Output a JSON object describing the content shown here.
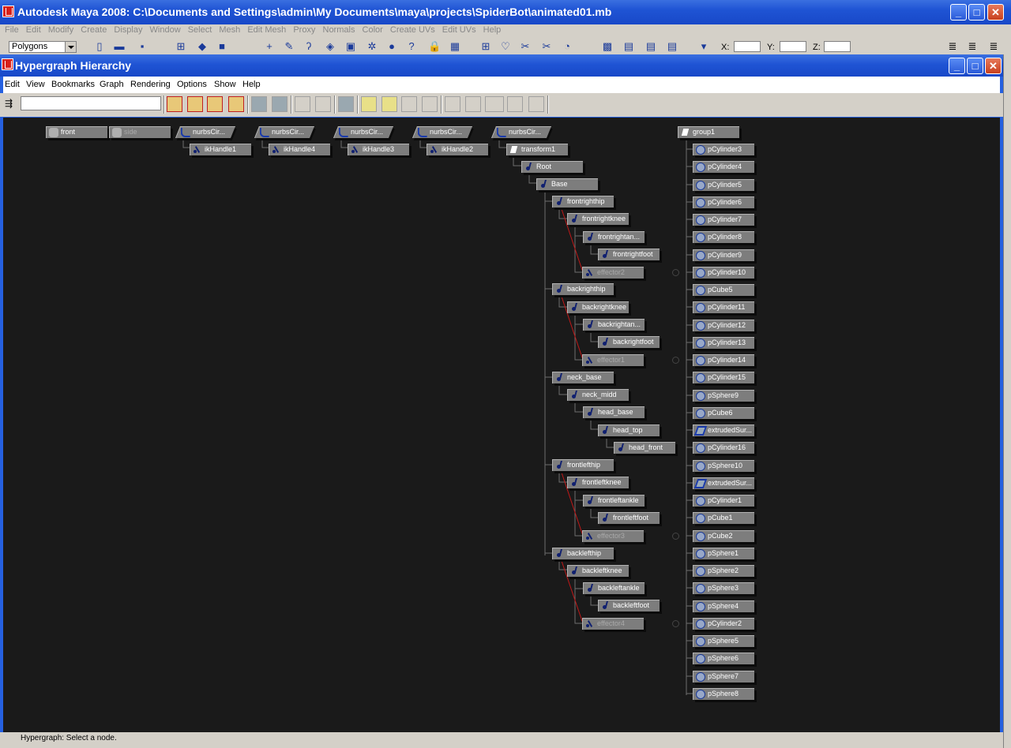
{
  "app": {
    "title": "Autodesk Maya 2008: C:\\Documents and Settings\\admin\\My Documents\\maya\\projects\\SpiderBot\\animated01.mb",
    "menus": [
      "File",
      "Edit",
      "Modify",
      "Create",
      "Display",
      "Window",
      "Select",
      "Mesh",
      "Edit Mesh",
      "Proxy",
      "Normals",
      "Color",
      "Create UVs",
      "Edit UVs",
      "Help"
    ],
    "menu_set": "Polygons",
    "coord_labels": {
      "x": "X:",
      "y": "Y:",
      "z": "Z:"
    },
    "window_buttons": {
      "min": "_",
      "max": "□",
      "close": "✕"
    }
  },
  "hypergraph": {
    "title": "Hypergraph Hierarchy",
    "menus": [
      "Edit",
      "View",
      "Bookmarks",
      "Graph",
      "Rendering",
      "Options",
      "Show",
      "Help"
    ],
    "status": "Hypergraph: Select a node."
  },
  "nodes": {
    "front": "front",
    "side": "side",
    "nurbs1": "nurbsCir...",
    "nurbs2": "nurbsCir...",
    "nurbs3": "nurbsCir...",
    "nurbs4": "nurbsCir...",
    "nurbs5": "nurbsCir...",
    "ik1": "ikHandle1",
    "ik4": "ikHandle4",
    "ik3": "ikHandle3",
    "ik2": "ikHandle2",
    "transform1": "transform1",
    "root": "Root",
    "base": "Base",
    "frh": "frontrighthip",
    "frk": "frontrightknee",
    "fra": "frontrightan...",
    "frf": "frontrightfoot",
    "eff2": "effector2",
    "brh": "backrighthip",
    "brk": "backrightknee",
    "bra": "backrightan...",
    "brf": "backrightfoot",
    "eff1": "effector1",
    "nb": "neck_base",
    "nm": "neck_midd",
    "hb": "head_base",
    "ht": "head_top",
    "hf": "head_front",
    "flh": "frontlefthip",
    "flk": "frontleftknee",
    "fla": "frontleftankle",
    "flf": "frontleftfoot",
    "eff3": "effector3",
    "blh": "backlefthip",
    "blk": "backleftknee",
    "bla": "backleftankle",
    "blf": "backleftfoot",
    "eff4": "effector4",
    "group1": "group1",
    "g_items": [
      "pCylinder3",
      "pCylinder4",
      "pCylinder5",
      "pCylinder6",
      "pCylinder7",
      "pCylinder8",
      "pCylinder9",
      "pCylinder10",
      "pCube5",
      "pCylinder11",
      "pCylinder12",
      "pCylinder13",
      "pCylinder14",
      "pCylinder15",
      "pSphere9",
      "pCube6",
      "extrudedSur...",
      "pCylinder16",
      "pSphere10",
      "extrudedSur...",
      "pCylinder1",
      "pCube1",
      "pCube2",
      "pSphere1",
      "pSphere2",
      "pSphere3",
      "pSphere4",
      "pCylinder2",
      "pSphere5",
      "pSphere6",
      "pSphere7",
      "pSphere8"
    ]
  },
  "colors": {
    "canvas": "#1a1a1a",
    "node": "#7d7d7d",
    "ik_link": "#c01818",
    "titlebar": "#1f54d4"
  }
}
